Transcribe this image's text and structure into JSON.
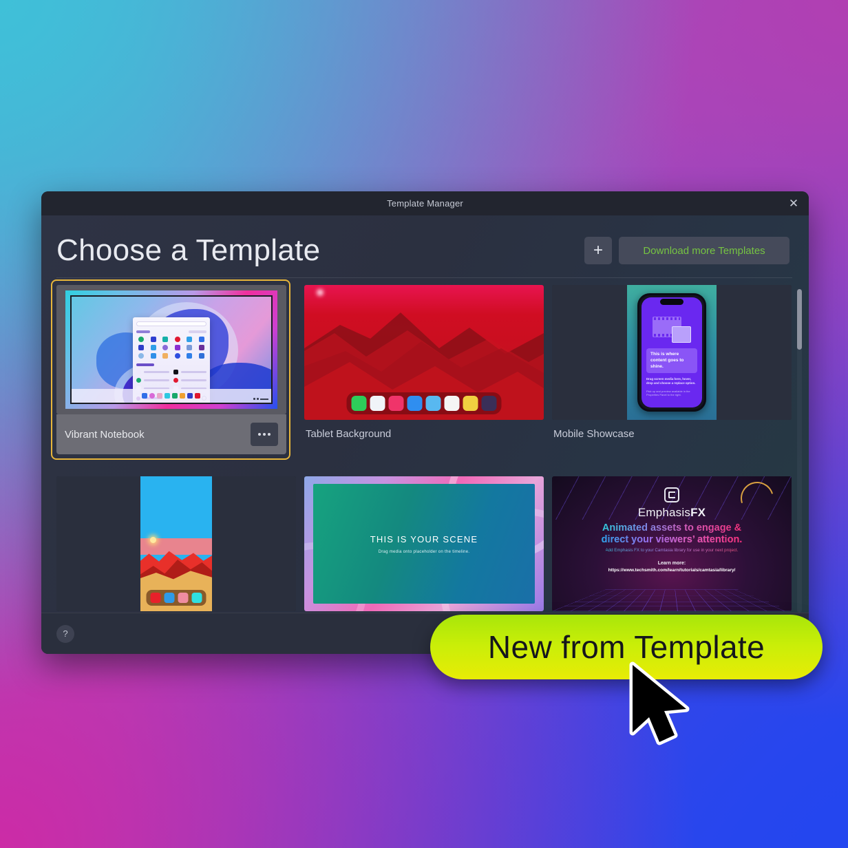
{
  "window": {
    "title": "Template Manager",
    "close_icon": "close-icon",
    "page_title": "Choose a Template",
    "add_button_label": "+",
    "download_button_label": "Download more Templates",
    "download_button_color": "#76c442",
    "help_button_label": "?"
  },
  "selection": {
    "selected_index": 0,
    "highlight_color": "#e8b63a"
  },
  "templates": [
    {
      "label": "Vibrant Notebook",
      "selected": true,
      "more_button": "...",
      "kind": "windows-desktop"
    },
    {
      "label": "Tablet Background",
      "selected": false,
      "kind": "tablet-red-mountains"
    },
    {
      "label": "Mobile Showcase",
      "selected": false,
      "kind": "phone-purple",
      "phone_heading": "This is where content goes to shine.",
      "phone_body": "Drag screen media here, hover, drop and choose a replace option.",
      "phone_note": "Pick up and preview available in the Properties Panel to the right."
    },
    {
      "label": "",
      "selected": false,
      "kind": "phone-sunset"
    },
    {
      "label": "",
      "selected": false,
      "kind": "scene",
      "scene_heading": "THIS IS YOUR SCENE",
      "scene_body": "Drag media onto placeholder on the timeline."
    },
    {
      "label": "",
      "selected": false,
      "kind": "emphasis-fx",
      "brand_light": "Emphasis",
      "brand_bold": "FX",
      "headline_line1": "Animated assets to engage &",
      "headline_line2": "direct your viewers’ attention.",
      "subline": "Add Emphasis FX to your Camtasia library for use in your next project.",
      "learn_more_label": "Learn more:",
      "url": "https://www.techsmith.com/learn/tutorials/camtasia/library/"
    }
  ],
  "callout": {
    "label": "New from Template",
    "gradient_start": "#a8e60a",
    "gradient_end": "#e8ec06"
  },
  "background": {
    "top_left": "#3fc0d8",
    "top_right": "#b13fb2",
    "bottom_left": "#cc2ba6",
    "bottom_right": "#2446ef"
  }
}
